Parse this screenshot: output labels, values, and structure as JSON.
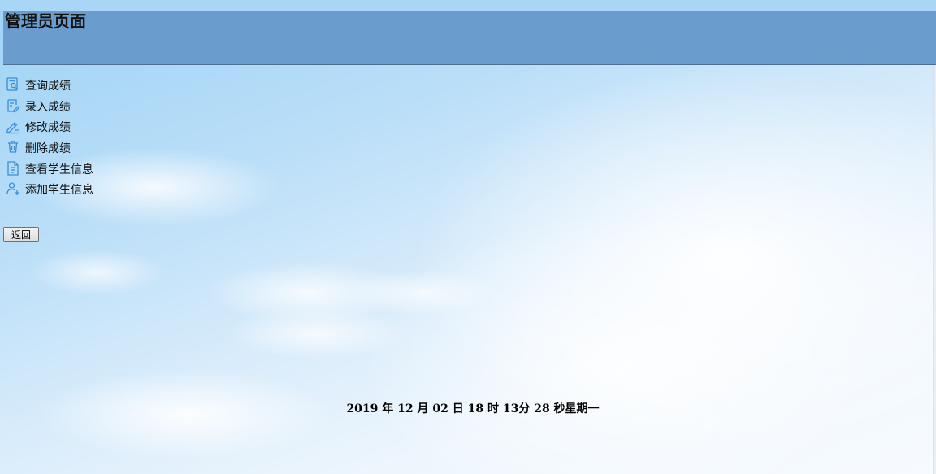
{
  "header": {
    "title": "管理员页面"
  },
  "menu": {
    "items": [
      {
        "label": "查询成绩",
        "icon": "search-document-icon"
      },
      {
        "label": "录入成绩",
        "icon": "edit-document-icon"
      },
      {
        "label": "修改成绩",
        "icon": "pen-edit-icon"
      },
      {
        "label": "删除成绩",
        "icon": "trash-icon"
      },
      {
        "label": "查看学生信息",
        "icon": "student-file-icon"
      },
      {
        "label": "添加学生信息",
        "icon": "add-user-icon"
      }
    ]
  },
  "actions": {
    "back_label": "返回"
  },
  "footer": {
    "datetime": "2019 年 12 月 02 日 18 时 13分 28 秒星期一"
  },
  "colors": {
    "header_bg": "#6a9ccd",
    "icon": "#3a8fd6"
  }
}
